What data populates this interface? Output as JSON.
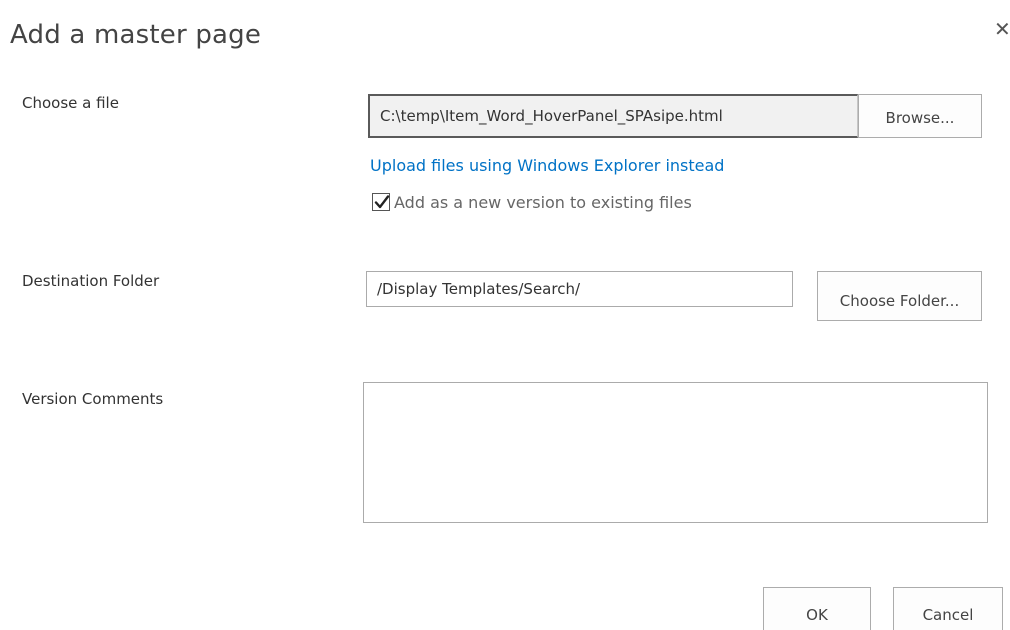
{
  "dialog": {
    "title": "Add a master page",
    "close_icon": "close-icon"
  },
  "choose_file": {
    "label": "Choose a file",
    "file_value": "C:\\temp\\Item_Word_HoverPanel_SPAsipe.html",
    "browse_label": "Browse...",
    "upload_link": "Upload files using Windows Explorer instead",
    "add_version_label": "Add as a new version to existing files",
    "add_version_checked": true
  },
  "destination": {
    "label": "Destination Folder",
    "folder_value": "/Display Templates/Search/",
    "choose_folder_label": "Choose Folder..."
  },
  "version_comments": {
    "label": "Version Comments",
    "value": ""
  },
  "footer": {
    "ok_label": "OK",
    "cancel_label": "Cancel"
  }
}
